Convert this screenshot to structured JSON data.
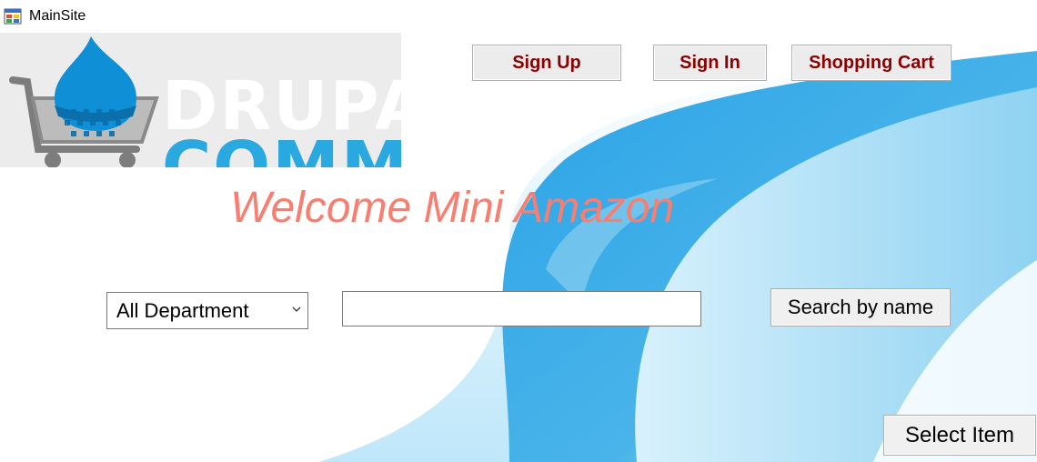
{
  "window": {
    "title": "MainSite",
    "icon": "app-window-icon"
  },
  "logo": {
    "word_top": "DRUPA",
    "word_bottom": "COMME",
    "icons": [
      "shopping-cart-icon",
      "drupal-drop-icon"
    ]
  },
  "nav": {
    "sign_up": "Sign Up",
    "sign_in": "Sign In",
    "shopping_cart": "Shopping Cart"
  },
  "welcome_text": "Welcome Mini Amazon",
  "search": {
    "department_selected": "All Department",
    "query_value": "",
    "search_button": "Search by name"
  },
  "select_item_button": "Select Item",
  "colors": {
    "nav_text": "#8b0000",
    "welcome_text": "#fa7e70",
    "swoosh_blue": "#2aa3e6",
    "swoosh_light": "#a8ddf5"
  }
}
